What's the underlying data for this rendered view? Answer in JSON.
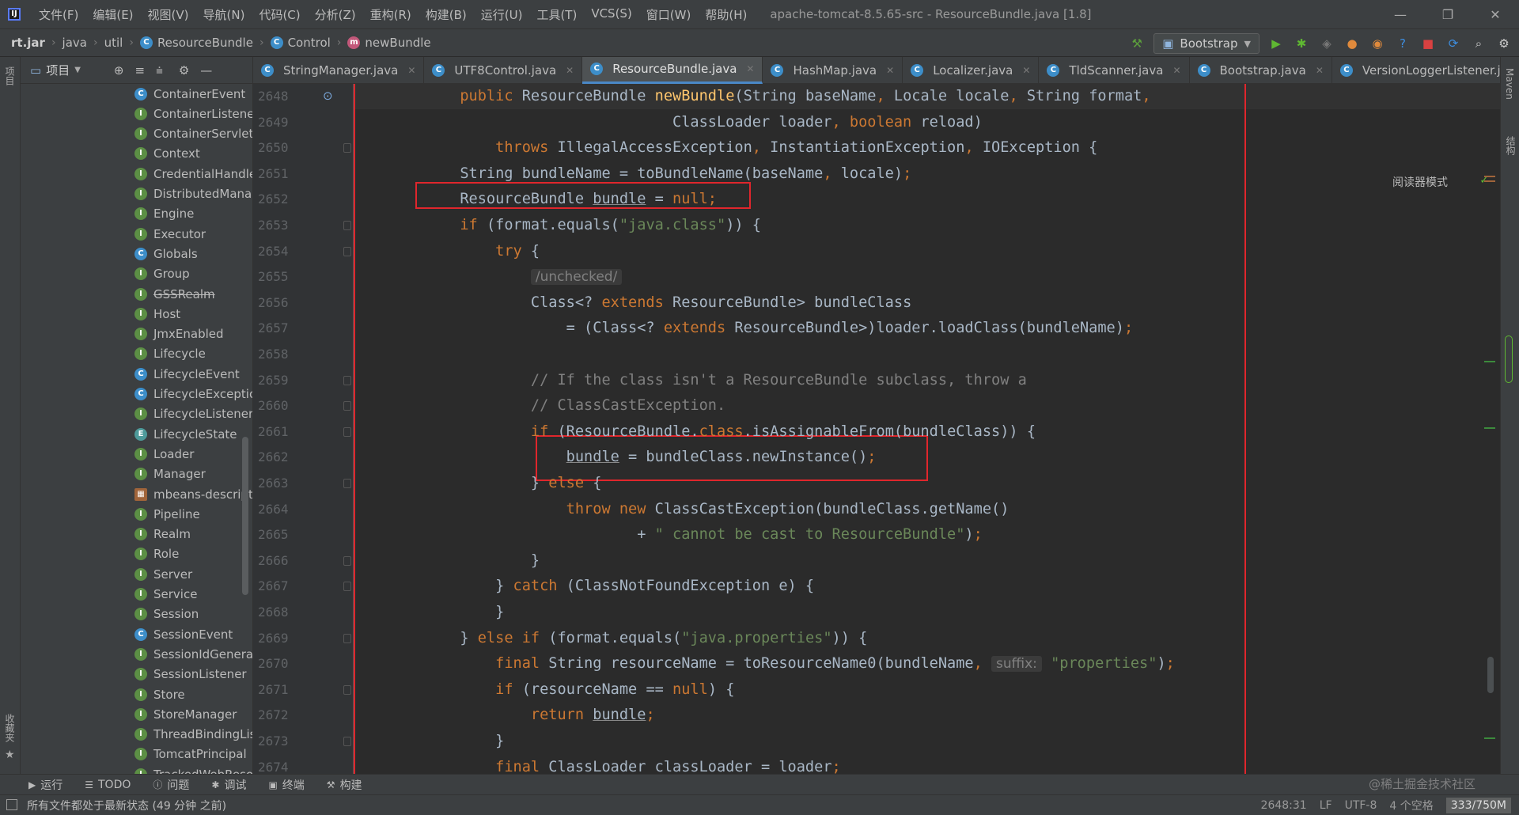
{
  "window": {
    "title": "apache-tomcat-8.5.65-src - ResourceBundle.java [1.8]",
    "menu": [
      "文件(F)",
      "编辑(E)",
      "视图(V)",
      "导航(N)",
      "代码(C)",
      "分析(Z)",
      "重构(R)",
      "构建(B)",
      "运行(U)",
      "工具(T)",
      "VCS(S)",
      "窗口(W)",
      "帮助(H)"
    ],
    "controls": {
      "minimize": "—",
      "restore": "❐",
      "close": "✕"
    }
  },
  "navbar": {
    "breadcrumbs": [
      "rt.jar",
      "java",
      "util",
      "ResourceBundle",
      "Control",
      "newBundle"
    ],
    "run_config": "Bootstrap"
  },
  "project_panel": {
    "title": "项目",
    "side_label": "项目",
    "fav_label": "收藏夹",
    "items": [
      {
        "label": "ContainerEvent",
        "kind": "class"
      },
      {
        "label": "ContainerListener",
        "kind": "interface"
      },
      {
        "label": "ContainerServlet",
        "kind": "interface"
      },
      {
        "label": "Context",
        "kind": "interface"
      },
      {
        "label": "CredentialHandler",
        "kind": "interface"
      },
      {
        "label": "DistributedManager",
        "kind": "interface"
      },
      {
        "label": "Engine",
        "kind": "interface"
      },
      {
        "label": "Executor",
        "kind": "interface"
      },
      {
        "label": "Globals",
        "kind": "class"
      },
      {
        "label": "Group",
        "kind": "interface"
      },
      {
        "label": "GSSRealm",
        "kind": "interface",
        "deprecated": true
      },
      {
        "label": "Host",
        "kind": "interface"
      },
      {
        "label": "JmxEnabled",
        "kind": "interface"
      },
      {
        "label": "Lifecycle",
        "kind": "interface"
      },
      {
        "label": "LifecycleEvent",
        "kind": "class"
      },
      {
        "label": "LifecycleException",
        "kind": "class"
      },
      {
        "label": "LifecycleListener",
        "kind": "interface"
      },
      {
        "label": "LifecycleState",
        "kind": "enum"
      },
      {
        "label": "Loader",
        "kind": "interface"
      },
      {
        "label": "Manager",
        "kind": "interface"
      },
      {
        "label": "mbeans-descriptors",
        "kind": "file"
      },
      {
        "label": "Pipeline",
        "kind": "interface"
      },
      {
        "label": "Realm",
        "kind": "interface"
      },
      {
        "label": "Role",
        "kind": "interface"
      },
      {
        "label": "Server",
        "kind": "interface"
      },
      {
        "label": "Service",
        "kind": "interface"
      },
      {
        "label": "Session",
        "kind": "interface"
      },
      {
        "label": "SessionEvent",
        "kind": "class"
      },
      {
        "label": "SessionIdGenerator",
        "kind": "interface"
      },
      {
        "label": "SessionListener",
        "kind": "interface"
      },
      {
        "label": "Store",
        "kind": "interface"
      },
      {
        "label": "StoreManager",
        "kind": "interface"
      },
      {
        "label": "ThreadBindingListener",
        "kind": "interface"
      },
      {
        "label": "TomcatPrincipal",
        "kind": "interface"
      },
      {
        "label": "TrackedWebResource",
        "kind": "interface"
      }
    ]
  },
  "tabs": [
    {
      "label": "StringManager.java",
      "active": false
    },
    {
      "label": "UTF8Control.java",
      "active": false
    },
    {
      "label": "ResourceBundle.java",
      "active": true
    },
    {
      "label": "HashMap.java",
      "active": false
    },
    {
      "label": "Localizer.java",
      "active": false
    },
    {
      "label": "TldScanner.java",
      "active": false
    },
    {
      "label": "Bootstrap.java",
      "active": false
    },
    {
      "label": "VersionLoggerListener.java",
      "active": false
    }
  ],
  "editor": {
    "reader_mode": "阅读器模式",
    "line_numbers": [
      "2648",
      "2649",
      "2650",
      "2651",
      "2652",
      "2653",
      "2654",
      "2655",
      "2656",
      "2657",
      "2658",
      "2659",
      "2660",
      "2661",
      "2662",
      "2663",
      "2664",
      "2665",
      "2666",
      "2667",
      "2668",
      "2669",
      "2670",
      "2671",
      "2672",
      "2673",
      "2674"
    ],
    "lines": [
      [
        [
          "            ",
          ""
        ],
        [
          "public ",
          "kw"
        ],
        [
          "ResourceBundle ",
          ""
        ],
        [
          "newBundle",
          "fn"
        ],
        [
          "(String baseName",
          ""
        ],
        [
          ", ",
          "kw"
        ],
        [
          "Locale locale",
          ""
        ],
        [
          ", ",
          "kw"
        ],
        [
          "String format",
          ""
        ],
        [
          ",",
          "kw"
        ]
      ],
      [
        [
          "                                    ClassLoader loader",
          ""
        ],
        [
          ", ",
          "kw"
        ],
        [
          "boolean ",
          "kw"
        ],
        [
          "reload)",
          ""
        ]
      ],
      [
        [
          "                ",
          ""
        ],
        [
          "throws ",
          "kw"
        ],
        [
          "IllegalAccessException",
          ""
        ],
        [
          ", ",
          "kw"
        ],
        [
          "InstantiationException",
          ""
        ],
        [
          ", ",
          "kw"
        ],
        [
          "IOException {",
          ""
        ]
      ],
      [
        [
          "            String bundleName = toBundleName(baseName",
          ""
        ],
        [
          ", ",
          "kw"
        ],
        [
          "locale)",
          ""
        ],
        [
          ";",
          "kw"
        ]
      ],
      [
        [
          "            ResourceBundle ",
          ""
        ],
        [
          "bundle",
          "und"
        ],
        [
          " = ",
          ""
        ],
        [
          "null",
          "kw"
        ],
        [
          ";",
          "kw"
        ]
      ],
      [
        [
          "            ",
          ""
        ],
        [
          "if ",
          "kw"
        ],
        [
          "(format.equals(",
          ""
        ],
        [
          "\"java.class\"",
          "str"
        ],
        [
          ")) {",
          ""
        ]
      ],
      [
        [
          "                ",
          ""
        ],
        [
          "try ",
          "kw"
        ],
        [
          "{",
          ""
        ]
      ],
      [
        [
          "                    ",
          ""
        ],
        [
          "/unchecked/",
          "chip"
        ]
      ],
      [
        [
          "                    Class<? ",
          ""
        ],
        [
          "extends ",
          "kw"
        ],
        [
          "ResourceBundle> bundleClass",
          ""
        ]
      ],
      [
        [
          "                        = (Class<? ",
          ""
        ],
        [
          "extends ",
          "kw"
        ],
        [
          "ResourceBundle>)loader.loadClass(bundleName)",
          ""
        ],
        [
          ";",
          "kw"
        ]
      ],
      [
        [
          "",
          ""
        ]
      ],
      [
        [
          "                    ",
          ""
        ],
        [
          "// If the class isn't a ResourceBundle subclass, throw a",
          "cmt"
        ]
      ],
      [
        [
          "                    ",
          ""
        ],
        [
          "// ClassCastException.",
          "cmt"
        ]
      ],
      [
        [
          "                    ",
          ""
        ],
        [
          "if ",
          "kw"
        ],
        [
          "(ResourceBundle.",
          ""
        ],
        [
          "class",
          "kw"
        ],
        [
          ".isAssignableFrom(bundleClass)) {",
          ""
        ]
      ],
      [
        [
          "                        ",
          ""
        ],
        [
          "bundle",
          "und"
        ],
        [
          " = bundleClass.newInstance()",
          ""
        ],
        [
          ";",
          "kw"
        ]
      ],
      [
        [
          "                    } ",
          ""
        ],
        [
          "else ",
          "kw"
        ],
        [
          "{",
          ""
        ]
      ],
      [
        [
          "                        ",
          ""
        ],
        [
          "throw new ",
          "kw"
        ],
        [
          "ClassCastException(bundleClass.getName()",
          ""
        ]
      ],
      [
        [
          "                                + ",
          ""
        ],
        [
          "\" cannot be cast to ResourceBundle\"",
          "str"
        ],
        [
          ")",
          ""
        ],
        [
          ";",
          "kw"
        ]
      ],
      [
        [
          "                    }",
          ""
        ]
      ],
      [
        [
          "                } ",
          ""
        ],
        [
          "catch ",
          "kw"
        ],
        [
          "(ClassNotFoundException e) {",
          ""
        ]
      ],
      [
        [
          "                }",
          ""
        ]
      ],
      [
        [
          "            } ",
          ""
        ],
        [
          "else if ",
          "kw"
        ],
        [
          "(format.equals(",
          ""
        ],
        [
          "\"java.properties\"",
          "str"
        ],
        [
          ")) {",
          ""
        ]
      ],
      [
        [
          "                ",
          ""
        ],
        [
          "final ",
          "kw"
        ],
        [
          "String resourceName = toResourceName0(bundleName",
          ""
        ],
        [
          ", ",
          "kw"
        ],
        [
          "suffix:",
          "chip"
        ],
        [
          " ",
          ""
        ],
        [
          "\"properties\"",
          "str"
        ],
        [
          ")",
          ""
        ],
        [
          ";",
          "kw"
        ]
      ],
      [
        [
          "                ",
          ""
        ],
        [
          "if ",
          "kw"
        ],
        [
          "(resourceName == ",
          ""
        ],
        [
          "null",
          "kw"
        ],
        [
          ") {",
          ""
        ]
      ],
      [
        [
          "                    ",
          ""
        ],
        [
          "return ",
          "kw"
        ],
        [
          "bundle",
          "und"
        ],
        [
          ";",
          "kw"
        ]
      ],
      [
        [
          "                }",
          ""
        ]
      ],
      [
        [
          "                ",
          ""
        ],
        [
          "final ",
          "kw"
        ],
        [
          "ClassLoader classLoader = loader",
          ""
        ],
        [
          ";",
          "kw"
        ]
      ]
    ]
  },
  "bottom_tools": [
    {
      "label": "运行",
      "icon": "play-icon"
    },
    {
      "label": "TODO",
      "icon": "list-icon"
    },
    {
      "label": "问题",
      "icon": "info-icon"
    },
    {
      "label": "调试",
      "icon": "bug-icon"
    },
    {
      "label": "终端",
      "icon": "terminal-icon"
    },
    {
      "label": "构建",
      "icon": "hammer-icon"
    }
  ],
  "status": {
    "message": "所有文件都处于最新状态 (49 分钟 之前)",
    "position": "2648:31",
    "line_sep": "LF",
    "encoding": "UTF-8",
    "indent": "4 个空格",
    "memory": "333/750M"
  },
  "right_strip": {
    "maven": "Maven",
    "structure": "结构"
  },
  "watermark": "@稀土掘金技术社区",
  "colors": {
    "keyword": "#cc7832",
    "string": "#6a8759",
    "comment": "#808080",
    "method": "#ffc66d",
    "highlight_box": "#e0262c",
    "active_tab": "#4a88c7"
  }
}
